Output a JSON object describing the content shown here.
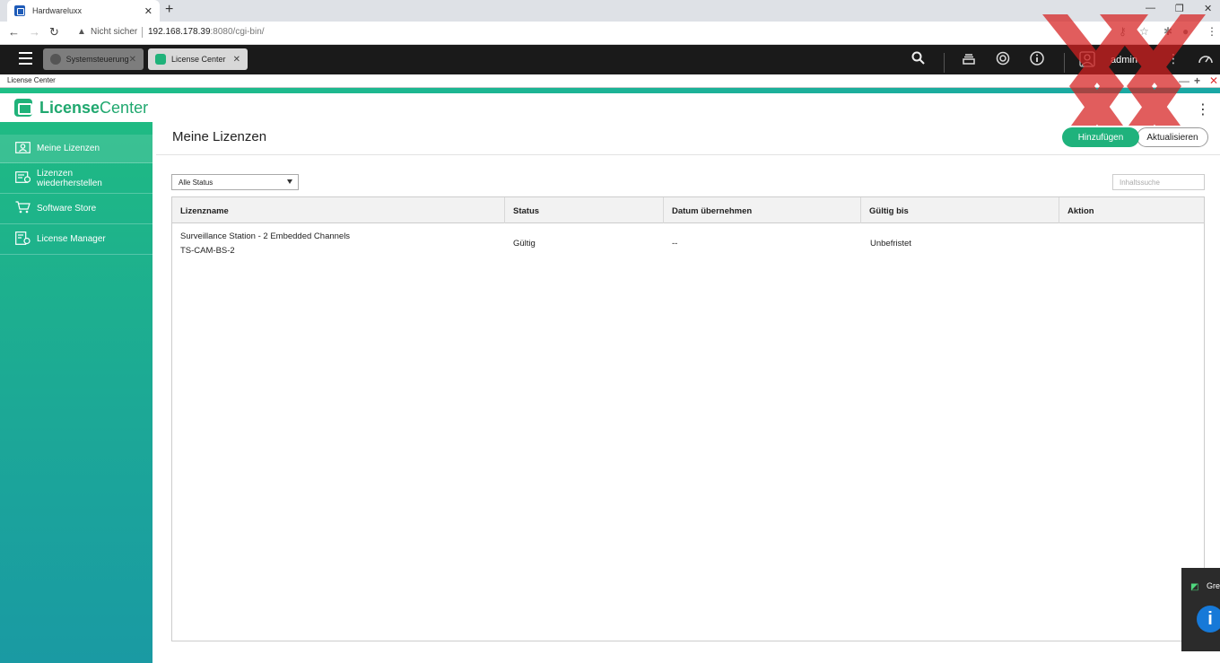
{
  "browser": {
    "tab_title": "Hardwareluxx",
    "tab_close": "✕",
    "new_tab": "+",
    "address_warning": "Nicht sicher",
    "url_host": "192.168.178.39",
    "url_rest": ":8080/cgi-bin/"
  },
  "qts": {
    "tabs": [
      {
        "label": "Systemsteuerung",
        "close": "✕"
      },
      {
        "label": "License Center",
        "close": "✕"
      }
    ],
    "user": "admin"
  },
  "window": {
    "title": "License Center",
    "minimize": "—",
    "maximize": "+",
    "close": "✕"
  },
  "app": {
    "name_bold": "License",
    "name_light": "Center"
  },
  "sidebar": {
    "items": [
      {
        "label": "Meine Lizenzen",
        "icon": "user-card-icon"
      },
      {
        "label": "Lizenzen wiederherstellen",
        "icon": "restore-license-icon"
      },
      {
        "label": "Software Store",
        "icon": "cart-icon"
      },
      {
        "label": "License Manager",
        "icon": "license-manager-icon"
      }
    ]
  },
  "main": {
    "title": "Meine Lizenzen",
    "add_button": "Hinzufügen",
    "refresh_button": "Aktualisieren",
    "filter_value": "Alle Status",
    "search_placeholder": "Inhaltssuche",
    "columns": [
      "Lizenzname",
      "Status",
      "Datum übernehmen",
      "Gültig bis",
      "Aktion"
    ],
    "rows": [
      {
        "name": "Surveillance Station - 2 Embedded Channels",
        "code": "TS-CAM-BS-2",
        "status": "Gültig",
        "date": "--",
        "valid_until": "Unbefristet",
        "action": ""
      }
    ]
  },
  "notification": {
    "text": "Gre",
    "icon_glyph": "i"
  },
  "colors": {
    "accent_green": "#1fb27c",
    "sidebar_top": "#1fba83",
    "sidebar_bottom": "#1a9aa3",
    "qts_bar": "#1a1a1a"
  }
}
